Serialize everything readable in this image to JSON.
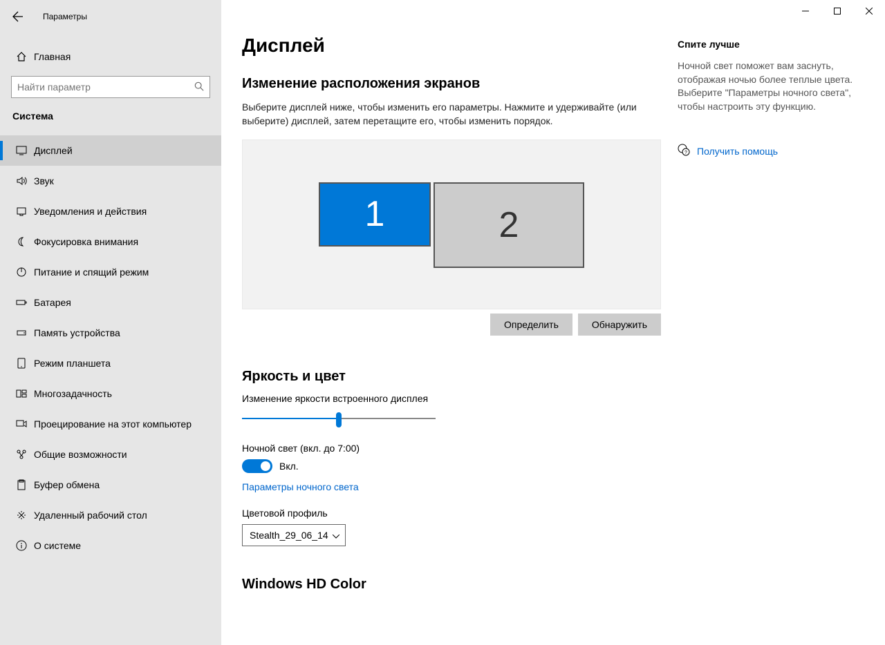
{
  "app_title": "Параметры",
  "home_label": "Главная",
  "search": {
    "placeholder": "Найти параметр"
  },
  "category": "Система",
  "nav": [
    {
      "label": "Дисплей"
    },
    {
      "label": "Звук"
    },
    {
      "label": "Уведомления и действия"
    },
    {
      "label": "Фокусировка внимания"
    },
    {
      "label": "Питание и спящий режим"
    },
    {
      "label": "Батарея"
    },
    {
      "label": "Память устройства"
    },
    {
      "label": "Режим планшета"
    },
    {
      "label": "Многозадачность"
    },
    {
      "label": "Проецирование на этот компьютер"
    },
    {
      "label": "Общие возможности"
    },
    {
      "label": "Буфер обмена"
    },
    {
      "label": "Удаленный рабочий стол"
    },
    {
      "label": "О системе"
    }
  ],
  "page": {
    "title": "Дисплей",
    "arrange_heading": "Изменение расположения экранов",
    "arrange_desc": "Выберите дисплей ниже, чтобы изменить его параметры. Нажмите и удерживайте (или выберите) дисплей, затем перетащите его, чтобы изменить порядок.",
    "monitors": {
      "m1": "1",
      "m2": "2"
    },
    "identify_btn": "Определить",
    "detect_btn": "Обнаружить",
    "brightness_heading": "Яркость и цвет",
    "brightness_label": "Изменение яркости встроенного дисплея",
    "night_light_label": "Ночной свет (вкл. до 7:00)",
    "toggle_on": "Вкл.",
    "night_light_settings": "Параметры ночного света",
    "color_profile_label": "Цветовой профиль",
    "color_profile_value": "Stealth_29_06_14",
    "hd_color_heading": "Windows HD Color"
  },
  "info": {
    "title": "Спите лучше",
    "text": "Ночной свет поможет вам заснуть, отображая ночью более теплые цвета. Выберите \"Параметры ночного света\", чтобы настроить эту функцию.",
    "help_label": "Получить помощь"
  }
}
